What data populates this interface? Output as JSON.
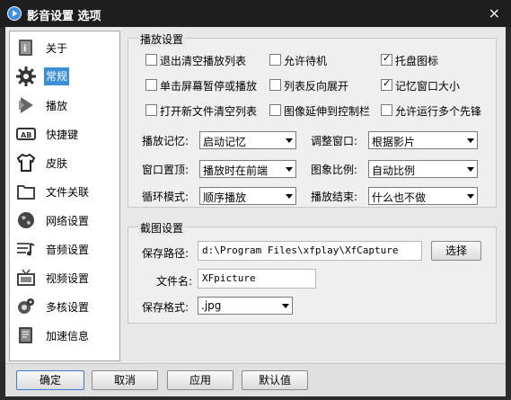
{
  "window": {
    "title": "影音设置 选项",
    "close": "×"
  },
  "sidebar": {
    "items": [
      {
        "label": "关于",
        "icon": "info-book-icon"
      },
      {
        "label": "常规",
        "icon": "gear-icon",
        "active": true
      },
      {
        "label": "播放",
        "icon": "play-arrow-icon"
      },
      {
        "label": "快捷键",
        "icon": "keyboard-icon"
      },
      {
        "label": "皮肤",
        "icon": "tshirt-icon"
      },
      {
        "label": "文件关联",
        "icon": "folder-icon"
      },
      {
        "label": "网络设置",
        "icon": "globe-icon"
      },
      {
        "label": "音频设置",
        "icon": "audio-icon"
      },
      {
        "label": "视频设置",
        "icon": "tv-icon"
      },
      {
        "label": "多核设置",
        "icon": "cpu-icon"
      },
      {
        "label": "加速信息",
        "icon": "speed-info-icon"
      }
    ]
  },
  "playback": {
    "title": "播放设置",
    "checkboxes": [
      {
        "label": "退出清空播放列表",
        "checked": false
      },
      {
        "label": "允许待机",
        "checked": false
      },
      {
        "label": "托盘图标",
        "checked": true
      },
      {
        "label": "单击屏幕暂停或播放",
        "checked": false
      },
      {
        "label": "列表反向展开",
        "checked": false
      },
      {
        "label": "记忆窗口大小",
        "checked": true
      },
      {
        "label": "打开新文件清空列表",
        "checked": false
      },
      {
        "label": "图像延伸到控制栏",
        "checked": false
      },
      {
        "label": "允许运行多个先锋",
        "checked": false
      }
    ],
    "selects": [
      {
        "label": "播放记忆:",
        "value": "启动记忆"
      },
      {
        "label": "调整窗口:",
        "value": "根据影片"
      },
      {
        "label": "窗口置顶:",
        "value": "播放时在前端"
      },
      {
        "label": "图象比例:",
        "value": "自动比例"
      },
      {
        "label": "循环模式:",
        "value": "顺序播放"
      },
      {
        "label": "播放结束:",
        "value": "什么也不做"
      }
    ]
  },
  "capture": {
    "title": "截图设置",
    "path_label": "保存路径:",
    "path_value": "d:\\Program Files\\xfplay\\XfCapture",
    "browse_label": "选择",
    "filename_label": "文件名:",
    "filename_value": "XFpicture",
    "format_label": "保存格式:",
    "format_value": ".jpg"
  },
  "buttons": {
    "ok": "确定",
    "cancel": "取消",
    "apply": "应用",
    "default": "默认值"
  }
}
